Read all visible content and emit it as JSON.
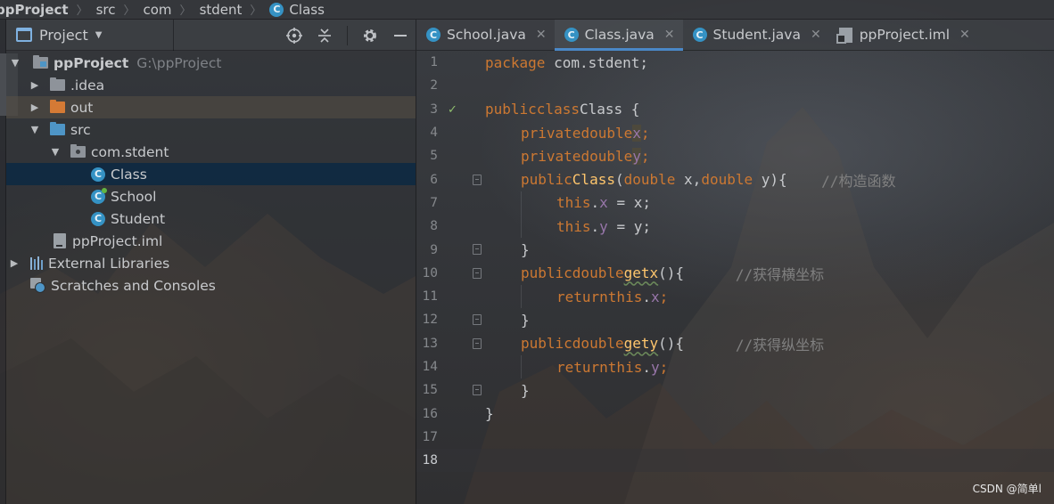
{
  "breadcrumb": [
    "ppProject",
    "src",
    "com",
    "stdent",
    "Class"
  ],
  "project_panel": {
    "title": "Project",
    "tree": [
      {
        "label": "ppProject",
        "hint": "G:\\ppProject"
      },
      {
        "label": ".idea"
      },
      {
        "label": "out"
      },
      {
        "label": "src"
      },
      {
        "label": "com.stdent"
      },
      {
        "label": "Class"
      },
      {
        "label": "School"
      },
      {
        "label": "Student"
      },
      {
        "label": "ppProject.iml"
      },
      {
        "label": "External Libraries"
      },
      {
        "label": "Scratches and Consoles"
      }
    ]
  },
  "tabs": [
    {
      "label": "School.java",
      "active": false
    },
    {
      "label": "Class.java",
      "active": true
    },
    {
      "label": "Student.java",
      "active": false
    },
    {
      "label": "ppProject.iml",
      "active": false
    }
  ],
  "editor": {
    "line_numbers": [
      "1",
      "2",
      "3",
      "4",
      "5",
      "6",
      "7",
      "8",
      "9",
      "10",
      "11",
      "12",
      "13",
      "14",
      "15",
      "16",
      "17",
      "18"
    ],
    "code": {
      "l1": {
        "kw": "package",
        "rest": " com.stdent;"
      },
      "l3": {
        "kw1": "public",
        "kw2": "class",
        "name": "Class",
        "brace": " {"
      },
      "l4": {
        "kw1": "private",
        "kw2": "double",
        "field": "x",
        "semi": ";"
      },
      "l5": {
        "kw1": "private",
        "kw2": "double",
        "field": "y",
        "semi": ";"
      },
      "l6": {
        "kw1": "public",
        "ctor": "Class",
        "p1": "(",
        "t1": "double",
        "a1": " x,",
        "t2": "double",
        "a2": " y){",
        "comment": "//构造函数"
      },
      "l7": {
        "this": "this",
        "dot": ".",
        "field": "x",
        "rest": " = x;"
      },
      "l8": {
        "this": "this",
        "dot": ".",
        "field": "y",
        "rest": " = y;"
      },
      "l9": "}",
      "l10": {
        "kw1": "public",
        "kw2": "double",
        "name": "getx",
        "rest": "(){",
        "comment": "//获得横坐标"
      },
      "l11": {
        "kw1": "return",
        "this": "this",
        "dot": ".",
        "field": "x",
        "semi": ";"
      },
      "l12": "}",
      "l13": {
        "kw1": "public",
        "kw2": "double",
        "name": "gety",
        "rest": "(){",
        "comment": "//获得纵坐标"
      },
      "l14": {
        "kw1": "return",
        "this": "this",
        "dot": ".",
        "field": "y",
        "semi": ";"
      },
      "l15": "}",
      "l16": "}"
    }
  },
  "watermark": "CSDN @简单l",
  "colors": {
    "keyword": "#cc7832",
    "function": "#ffc66d",
    "field": "#9876aa",
    "comment": "#808080",
    "accent": "#4a88c7"
  }
}
